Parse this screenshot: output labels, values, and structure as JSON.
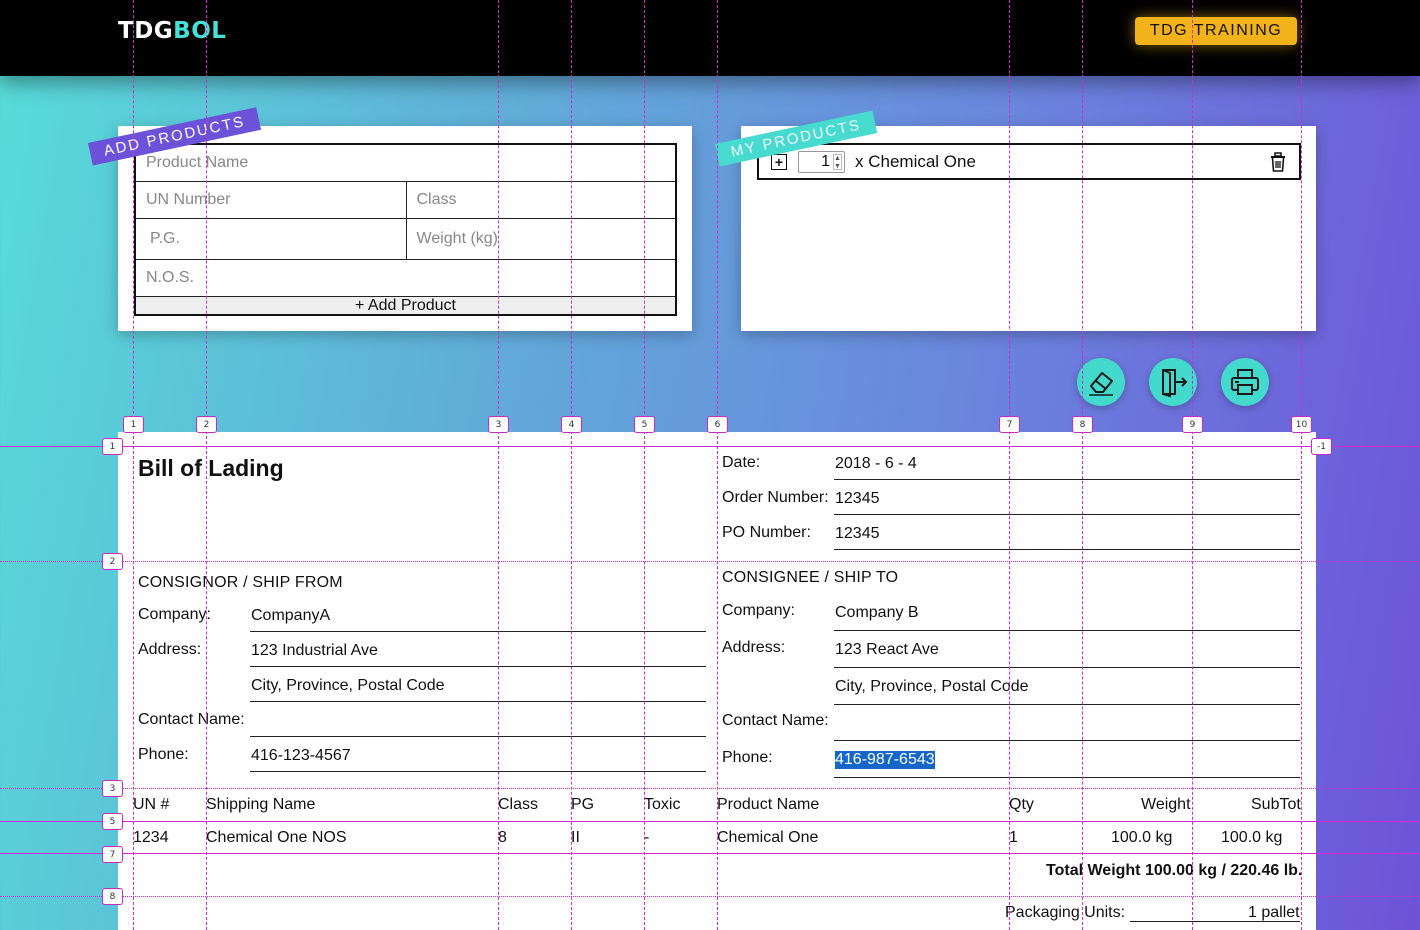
{
  "app": {
    "logo_part1": "TDG",
    "logo_part2": "BOL",
    "training_button": "TDG TRAINING"
  },
  "add_products": {
    "ribbon": "ADD PRODUCTS",
    "product_name_placeholder": "Product Name",
    "un_number_placeholder": "UN Number",
    "class_placeholder": "Class",
    "pg_placeholder": "P.G.",
    "weight_placeholder": "Weight (kg)",
    "nos_placeholder": "N.O.S.",
    "add_button": "+ Add Product"
  },
  "my_products": {
    "ribbon": "MY PRODUCTS",
    "items": [
      {
        "qty": "1",
        "label": "x Chemical One"
      }
    ]
  },
  "actions": {
    "icons": [
      "eraser-icon",
      "exit-icon",
      "printer-icon"
    ]
  },
  "bill": {
    "title": "Bill of Lading",
    "date_label": "Date:",
    "date_value": "2018 - 6 - 4",
    "order_label": "Order Number:",
    "order_value": "12345",
    "po_label": "PO Number:",
    "po_value": "12345",
    "consignor": {
      "heading": "CONSIGNOR / SHIP FROM",
      "company_label": "Company:",
      "company": "CompanyA",
      "address_label": "Address:",
      "address1": "123 Industrial Ave",
      "address2": "City, Province, Postal Code",
      "contact_label": "Contact Name:",
      "contact": "",
      "phone_label": "Phone:",
      "phone": "416-123-4567"
    },
    "consignee": {
      "heading": "CONSIGNEE / SHIP TO",
      "company_label": "Company:",
      "company": "Company B",
      "address_label": "Address:",
      "address1": "123 React Ave",
      "address2": "City, Province, Postal Code",
      "contact_label": "Contact Name:",
      "contact": "",
      "phone_label": "Phone:",
      "phone": "416-987-6543"
    },
    "table": {
      "headers": [
        "UN #",
        "Shipping Name",
        "Class",
        "PG",
        "Toxic",
        "Product Name",
        "Qty",
        "Weight",
        "SubTot"
      ],
      "rows": [
        [
          "1234",
          "Chemical One NOS",
          "8",
          "II",
          "-",
          "Chemical One",
          "1",
          "100.0 kg",
          "100.0 kg"
        ]
      ]
    },
    "total": "Total Weight 100.00 kg / 220.46 lb.",
    "packaging_label": "Packaging Units:",
    "packaging_value": "1 pallet"
  },
  "guides": {
    "column_tags": [
      "1",
      "2",
      "3",
      "4",
      "5",
      "6",
      "7",
      "8",
      "9",
      "10"
    ],
    "row_tags": [
      "1",
      "2",
      "3",
      "5",
      "7",
      "8"
    ],
    "end_tag": "-1"
  },
  "colors": {
    "accent_gold": "#f1b21a",
    "accent_teal": "#47dbd0",
    "accent_purple": "#6b52d9",
    "guide_magenta": "#d02ad0",
    "selection_blue": "#1467c8"
  }
}
